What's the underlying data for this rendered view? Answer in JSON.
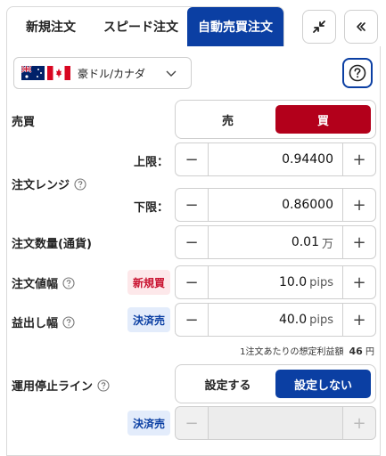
{
  "tabs": [
    {
      "label": "新規注文"
    },
    {
      "label": "スピード注文"
    },
    {
      "label": "自動売買注文"
    }
  ],
  "pair": {
    "name": "豪ドル/カナダ"
  },
  "side": {
    "label": "売買",
    "sell": "売",
    "buy": "買",
    "selected": "buy"
  },
  "range": {
    "label": "注文レンジ",
    "upper_label": "上限：",
    "upper_value": "0.94400",
    "lower_label": "下限：",
    "lower_value": "0.86000"
  },
  "quantity": {
    "label": "注文数量(通貨)",
    "value": "0.01",
    "unit": "万"
  },
  "width": {
    "label": "注文値幅",
    "tag": "新規買",
    "value": "10.0",
    "unit": "pips"
  },
  "profit_width": {
    "label": "益出し幅",
    "tag": "決済売",
    "value": "40.0",
    "unit": "pips"
  },
  "estimate": {
    "label": "1注文あたりの想定利益額",
    "value": "46",
    "unit": "円"
  },
  "stop_line": {
    "label": "運用停止ライン",
    "set": "設定する",
    "unset": "設定しない",
    "selected": "unset",
    "tag": "決済売"
  },
  "colors": {
    "accent": "#0b3fa3",
    "buy": "#b3001b"
  }
}
